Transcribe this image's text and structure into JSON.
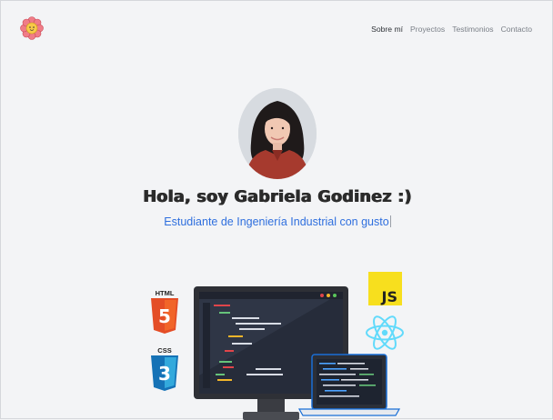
{
  "nav": {
    "logo": "flower-logo-icon",
    "items": [
      {
        "label": "Sobre mí",
        "active": true
      },
      {
        "label": "Proyectos",
        "active": false
      },
      {
        "label": "Testimonios",
        "active": false
      },
      {
        "label": "Contacto",
        "active": false
      }
    ]
  },
  "hero": {
    "title": "Hola, soy Gabriela Godinez :)",
    "subtitle": "Estudiante de Ingeniería Industrial con gusto"
  },
  "badges": {
    "html_label": "HTML",
    "html_number": "5",
    "css_label": "CSS",
    "css_number": "3",
    "js_label": "JS"
  },
  "colors": {
    "accent": "#2f6fde",
    "background": "#f3f4f6",
    "html": "#e44d26",
    "css": "#1572b6",
    "js": "#f7df1e",
    "react": "#61dafb"
  }
}
